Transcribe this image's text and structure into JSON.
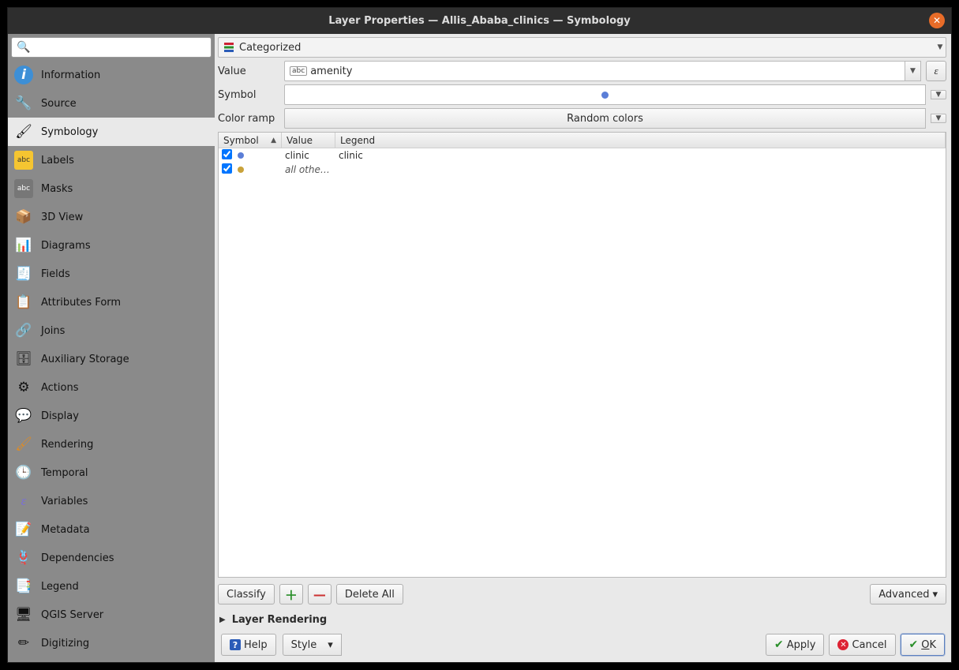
{
  "title": "Layer Properties — Allis_Ababa_clinics — Symbology",
  "search": {
    "placeholder": ""
  },
  "sidebar": {
    "items": [
      {
        "key": "information",
        "label": "Information",
        "icon": "info"
      },
      {
        "key": "source",
        "label": "Source",
        "icon": "source"
      },
      {
        "key": "symbology",
        "label": "Symbology",
        "icon": "symbology",
        "selected": true
      },
      {
        "key": "labels",
        "label": "Labels",
        "icon": "labels"
      },
      {
        "key": "masks",
        "label": "Masks",
        "icon": "masks"
      },
      {
        "key": "3dview",
        "label": "3D View",
        "icon": "3d"
      },
      {
        "key": "diagrams",
        "label": "Diagrams",
        "icon": "diagrams"
      },
      {
        "key": "fields",
        "label": "Fields",
        "icon": "fields"
      },
      {
        "key": "attrform",
        "label": "Attributes Form",
        "icon": "attrform"
      },
      {
        "key": "joins",
        "label": "Joins",
        "icon": "joins"
      },
      {
        "key": "aux",
        "label": "Auxiliary Storage",
        "icon": "aux"
      },
      {
        "key": "actions",
        "label": "Actions",
        "icon": "actions"
      },
      {
        "key": "display",
        "label": "Display",
        "icon": "display"
      },
      {
        "key": "rendering",
        "label": "Rendering",
        "icon": "rendering"
      },
      {
        "key": "temporal",
        "label": "Temporal",
        "icon": "temporal"
      },
      {
        "key": "variables",
        "label": "Variables",
        "icon": "variables"
      },
      {
        "key": "metadata",
        "label": "Metadata",
        "icon": "metadata"
      },
      {
        "key": "dependencies",
        "label": "Dependencies",
        "icon": "dependencies"
      },
      {
        "key": "legend",
        "label": "Legend",
        "icon": "legend"
      },
      {
        "key": "qgis",
        "label": "QGIS Server",
        "icon": "qgis"
      },
      {
        "key": "digitizing",
        "label": "Digitizing",
        "icon": "digitizing"
      }
    ]
  },
  "symbology": {
    "renderer_type": "Categorized",
    "value_label": "Value",
    "value_field": "amenity",
    "symbol_label": "Symbol",
    "color_ramp_label": "Color ramp",
    "color_ramp": "Random colors",
    "table": {
      "headers": {
        "symbol": "Symbol",
        "value": "Value",
        "legend": "Legend"
      },
      "rows": [
        {
          "checked": true,
          "color": "#5b7ed7",
          "value": "clinic",
          "legend": "clinic",
          "italic": false
        },
        {
          "checked": true,
          "color": "#c9a23a",
          "value": "all othe…",
          "legend": "",
          "italic": true
        }
      ]
    },
    "buttons": {
      "classify": "Classify",
      "delete_all": "Delete All",
      "advanced": "Advanced"
    },
    "layer_rendering": "Layer Rendering"
  },
  "footer": {
    "help": "Help",
    "style": "Style",
    "apply": "Apply",
    "cancel": "Cancel",
    "ok": "OK"
  }
}
